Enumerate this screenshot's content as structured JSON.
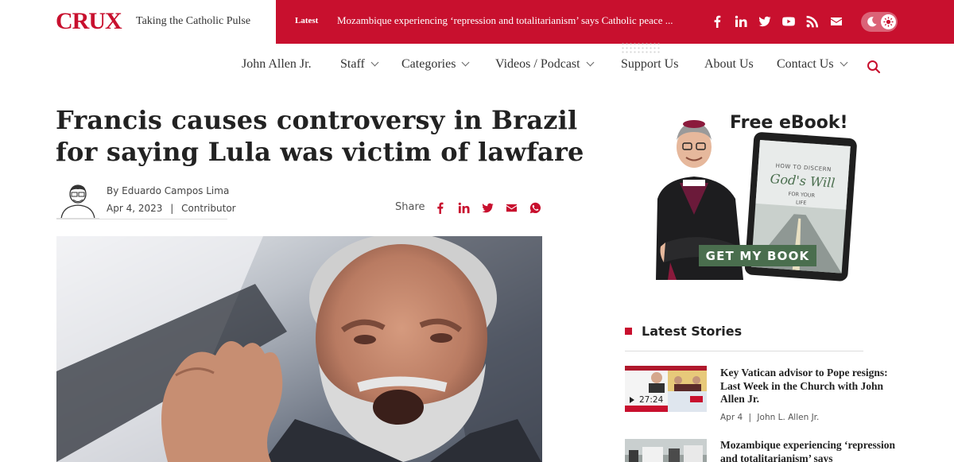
{
  "brand": {
    "logo": "CRUX",
    "tagline": "Taking the Catholic Pulse",
    "accent_color": "#c8102e"
  },
  "ticker": {
    "label": "Latest",
    "headline": "Mozambique experiencing ‘repression and totalitarianism’ says Catholic peace ..."
  },
  "social_icons": [
    "facebook-icon",
    "linkedin-icon",
    "twitter-icon",
    "youtube-icon",
    "rss-icon",
    "email-icon"
  ],
  "nav": {
    "items": [
      {
        "label": "John Allen Jr.",
        "dropdown": false
      },
      {
        "label": "Staff",
        "dropdown": true
      },
      {
        "label": "Categories",
        "dropdown": true
      },
      {
        "label": "Videos / Podcast",
        "dropdown": true
      },
      {
        "label": "Support Us",
        "dropdown": false
      },
      {
        "label": "About Us",
        "dropdown": false
      },
      {
        "label": "Contact Us",
        "dropdown": true
      }
    ]
  },
  "article": {
    "title": "Francis causes controversy in Brazil for saying Lula was victim of lawfare",
    "byline": "By Eduardo Campos Lima",
    "date": "Apr 4, 2023",
    "role": "Contributor",
    "share_label": "Share",
    "share_icons": [
      "facebook-icon",
      "linkedin-icon",
      "twitter-icon",
      "email-icon",
      "whatsapp-icon"
    ]
  },
  "ad": {
    "title": "Free eBook!",
    "book_title": "HOW TO DISCERN God's Will FOR YOUR LIFE",
    "cta": "GET MY BOOK"
  },
  "latest": {
    "heading": "Latest Stories",
    "stories": [
      {
        "title": "Key Vatican advisor to Pope resigns: Last Week in the Church with John Allen Jr.",
        "date": "Apr 4",
        "author": "John L. Allen Jr.",
        "duration": "27:24"
      },
      {
        "title": "Mozambique experiencing ‘repression and totalitarianism’ says",
        "date": "",
        "author": "",
        "duration": ""
      }
    ]
  }
}
